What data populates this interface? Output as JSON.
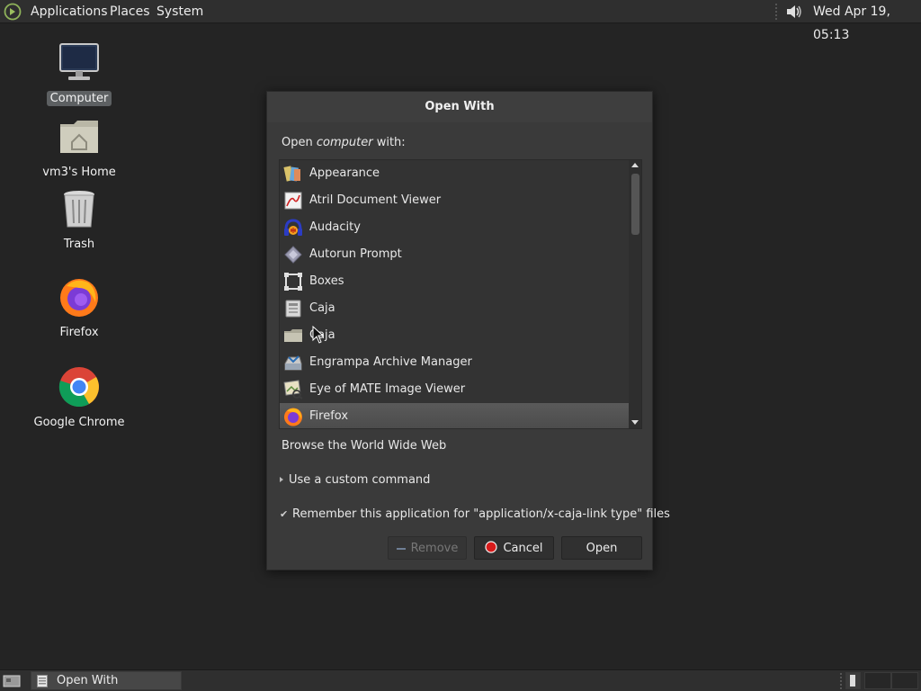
{
  "top_panel": {
    "menus": [
      "Applications",
      "Places",
      "System"
    ],
    "clock": "Wed Apr 19, 05:13"
  },
  "desktop_icons": [
    {
      "label": "Computer",
      "icon": "computer-icon",
      "selected": true
    },
    {
      "label": "vm3's Home",
      "icon": "home-folder-icon"
    },
    {
      "label": "Trash",
      "icon": "trash-icon"
    },
    {
      "label": "Firefox",
      "icon": "firefox-icon"
    },
    {
      "label": "Google Chrome",
      "icon": "chrome-icon"
    }
  ],
  "dialog": {
    "title": "Open With",
    "prompt_prefix": "Open ",
    "prompt_object": "computer",
    "prompt_suffix": " with:",
    "apps": [
      {
        "name": "Appearance",
        "icon": "appearance-icon"
      },
      {
        "name": "Atril Document Viewer",
        "icon": "atril-icon"
      },
      {
        "name": "Audacity",
        "icon": "audacity-icon"
      },
      {
        "name": "Autorun Prompt",
        "icon": "autorun-icon"
      },
      {
        "name": "Boxes",
        "icon": "boxes-icon"
      },
      {
        "name": "Caja",
        "icon": "caja-icon"
      },
      {
        "name": "Caja",
        "icon": "folder-icon"
      },
      {
        "name": "Engrampa Archive Manager",
        "icon": "archive-icon"
      },
      {
        "name": "Eye of MATE Image Viewer",
        "icon": "image-viewer-icon"
      },
      {
        "name": "Firefox",
        "icon": "firefox-icon",
        "selected": true
      }
    ],
    "description": "Browse the World Wide Web",
    "custom_command_label": "Use a custom command",
    "remember_label": "Remember this application for \"application/x-caja-link type\" files",
    "remember_checked": true,
    "buttons": {
      "remove": "Remove",
      "cancel": "Cancel",
      "open": "Open"
    }
  },
  "bottom_panel": {
    "task_label": "Open With"
  }
}
